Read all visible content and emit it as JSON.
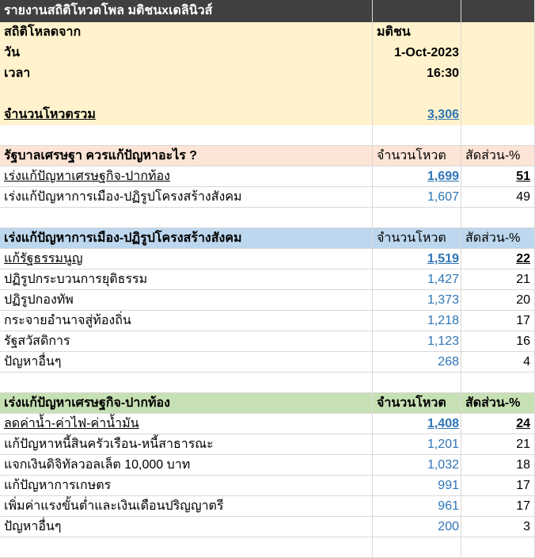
{
  "title": "รายงานสถิติโหวตโพล มติชนxเดลินิวส์",
  "info": {
    "source_label": "สถิติโหลดจาก",
    "source_value": "มติชน",
    "date_label": "วัน",
    "date_value": "1-Oct-2023",
    "time_label": "เวลา",
    "time_value": "16:30",
    "total_label": "จำนวนโหวตรวม",
    "total_value": "3,306"
  },
  "sections": [
    {
      "header": "รัฐบาลเศรษฐา ควรแก้ปัญหาอะไร ?",
      "col_votes": "จำนวนโหวต",
      "col_share": "สัดส่วน-%",
      "rows": [
        {
          "label": "เร่งแก้ปัญหาเศรษฐกิจ-ปากท้อง",
          "votes": "1,699",
          "share": "51"
        },
        {
          "label": "เร่งแก้ปัญหาการเมือง-ปฏิรูปโครงสร้างสังคม",
          "votes": "1,607",
          "share": "49"
        }
      ]
    },
    {
      "header": "เร่งแก้ปัญหาการเมือง-ปฏิรูปโครงสร้างสังคม",
      "col_votes": "จำนวนโหวต",
      "col_share": "สัดส่วน-%",
      "rows": [
        {
          "label": "แก้รัฐธรรมนูญ",
          "votes": "1,519",
          "share": "22"
        },
        {
          "label": "ปฏิรูปกระบวนการยุติธรรม",
          "votes": "1,427",
          "share": "21"
        },
        {
          "label": "ปฏิรูปกองทัพ",
          "votes": "1,373",
          "share": "20"
        },
        {
          "label": "กระจายอำนาจสู่ท้องถิ่น",
          "votes": "1,218",
          "share": "17"
        },
        {
          "label": "รัฐสวัสดิการ",
          "votes": "1,123",
          "share": "16"
        },
        {
          "label": "ปัญหาอื่นๆ",
          "votes": "268",
          "share": "4"
        }
      ]
    },
    {
      "header": "เร่งแก้ปัญหาเศรษฐกิจ-ปากท้อง",
      "col_votes": "จำนวนโหวต",
      "col_share": "สัดส่วน-%",
      "rows": [
        {
          "label": "ลดค่าน้ำ-ค่าไฟ-ค่าน้ำมัน",
          "votes": "1,408",
          "share": "24"
        },
        {
          "label": "แก้ปัญหาหนี้สินครัวเรือน-หนี้สาธารณะ",
          "votes": "1,201",
          "share": "21"
        },
        {
          "label": "แจกเงินดิจิทัลวอลเล็ต 10,000 บาท",
          "votes": "1,032",
          "share": "18"
        },
        {
          "label": "แก้ปัญหาการเกษตร",
          "votes": "991",
          "share": "17"
        },
        {
          "label": "เพิ่มค่าแรงขั้นต่ำและเงินเดือนปริญญาตรี",
          "votes": "961",
          "share": "17"
        },
        {
          "label": "ปัญหาอื่นๆ",
          "votes": "200",
          "share": "3"
        }
      ]
    }
  ]
}
